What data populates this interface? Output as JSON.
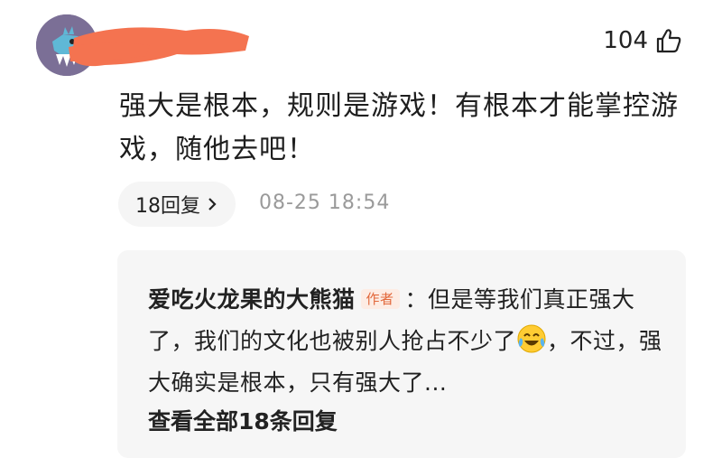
{
  "comment": {
    "likes": "104",
    "text": "强大是根本，规则是游戏！有根本才能掌控游戏，随他去吧！",
    "reply_chip_label": "18回复",
    "timestamp": "08-25 18:54"
  },
  "reply": {
    "author": "爱吃火龙果的大熊猫",
    "author_badge": "作者",
    "text_part1": "：但是等我们真正强大了，我们的文化也被别人抢占不少了",
    "text_part2": "，不过，强大确实是根本，只有强大了...",
    "view_all_label": "查看全部18条回复"
  },
  "colors": {
    "redaction": "#f47350",
    "avatar_bg": "#7b6f96",
    "badge_text": "#e2673a"
  },
  "icons": {
    "like": "thumbs-up-icon",
    "chevron": "chevron-right-icon",
    "emoji": "laughing-crying-emoji-icon"
  }
}
